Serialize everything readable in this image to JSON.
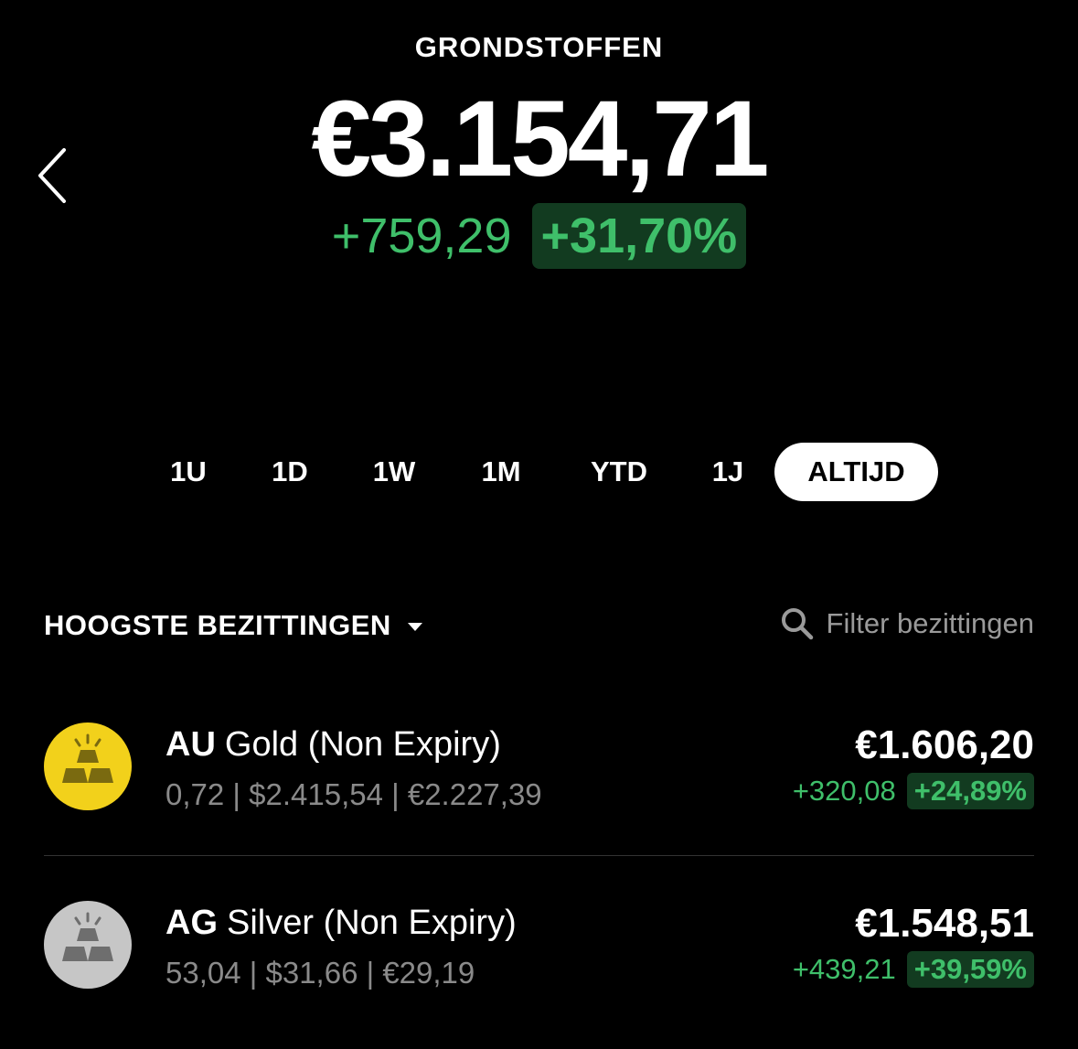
{
  "header": {
    "title": "GRONDSTOFFEN",
    "total": "€3.154,71",
    "change_abs": "+759,29",
    "change_pct": "+31,70%"
  },
  "ranges": [
    "1U",
    "1D",
    "1W",
    "1M",
    "YTD",
    "1J",
    "ALTIJD"
  ],
  "active_range": "ALTIJD",
  "holdings": {
    "section_title": "HOOGSTE BEZITTINGEN",
    "filter_placeholder": "Filter bezittingen",
    "items": [
      {
        "symbol": "AU",
        "name": "Gold (Non Expiry)",
        "meta": "0,72 | $2.415,54 | €2.227,39",
        "value": "€1.606,20",
        "change_abs": "+320,08",
        "change_pct": "+24,89%",
        "icon": "gold-bars-icon",
        "icon_color": "#f2d11b"
      },
      {
        "symbol": "AG",
        "name": "Silver (Non Expiry)",
        "meta": "53,04 | $31,66 | €29,19",
        "value": "€1.548,51",
        "change_abs": "+439,21",
        "change_pct": "+39,59%",
        "icon": "silver-bars-icon",
        "icon_color": "#c6c6c6"
      }
    ]
  },
  "colors": {
    "positive": "#3fbf6a",
    "positive_bg": "#123b20",
    "background": "#000000"
  }
}
